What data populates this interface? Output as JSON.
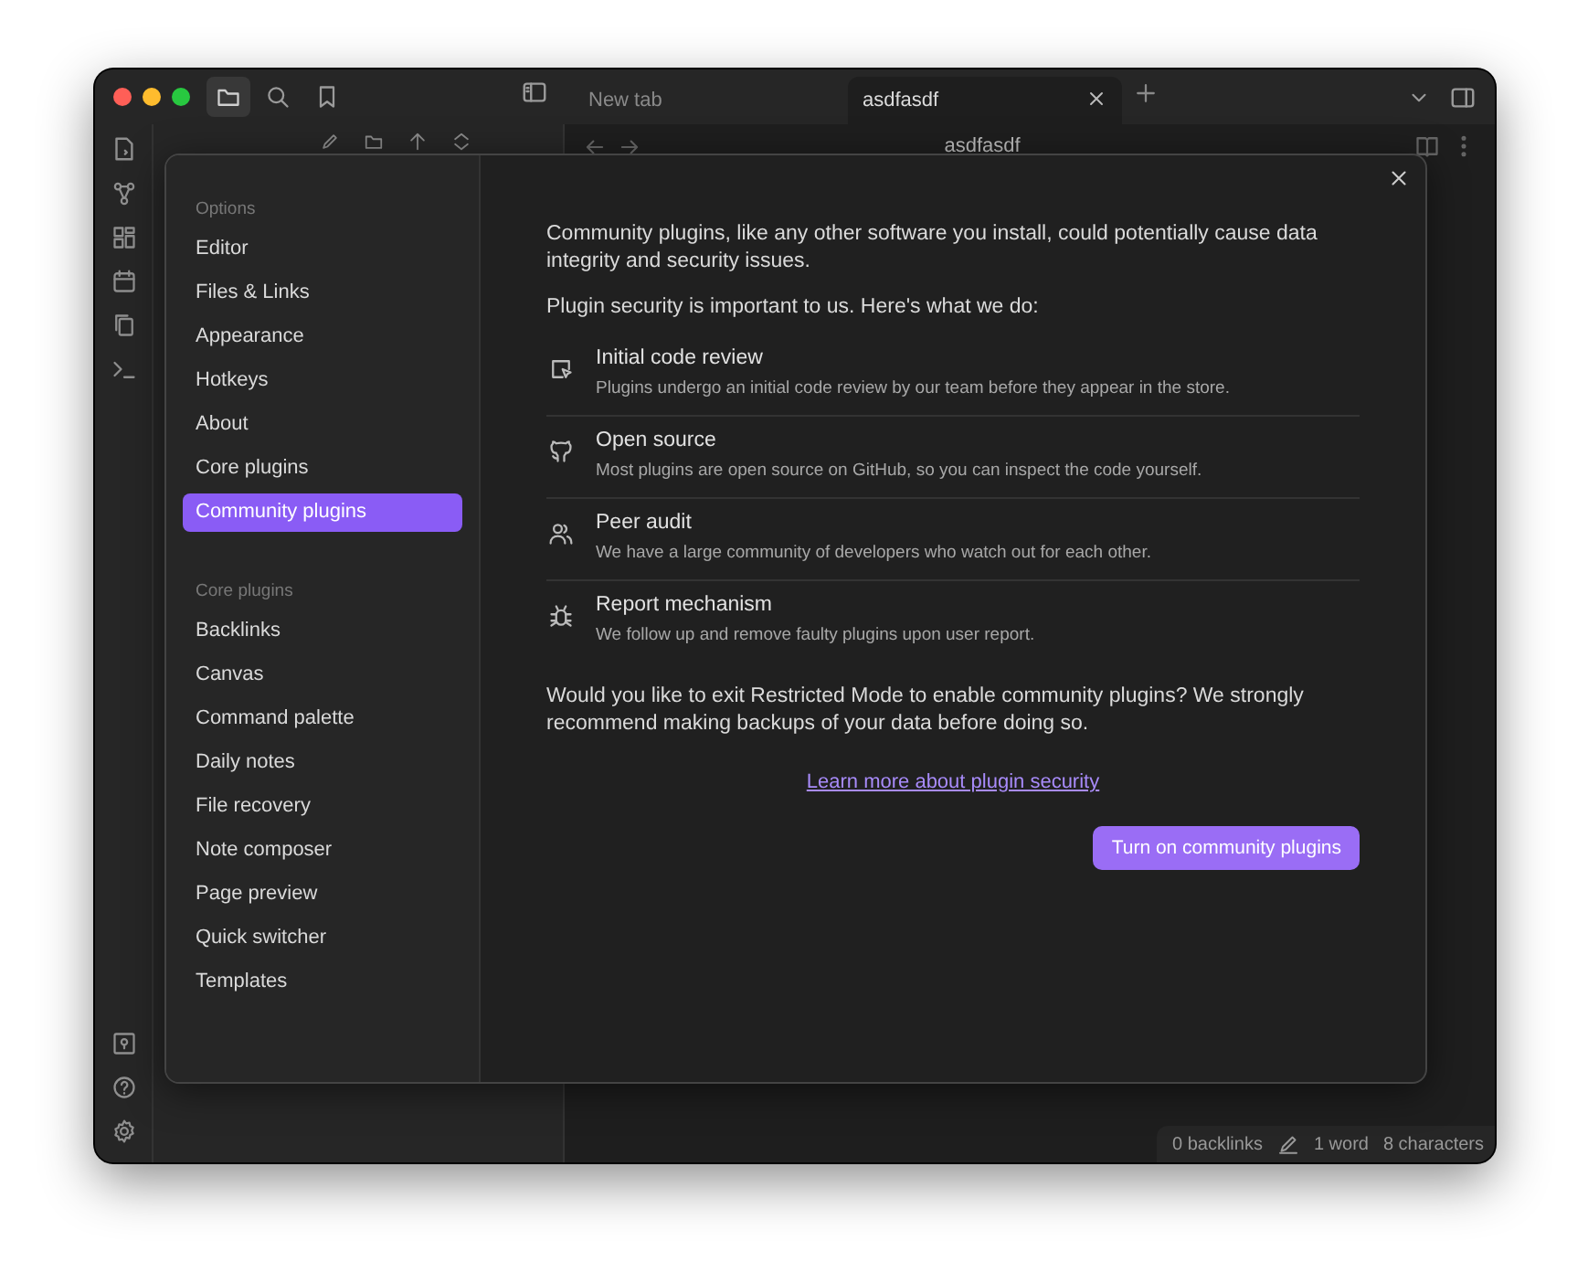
{
  "tab_bar": {
    "tools": [
      {
        "kind": "files",
        "selected": true
      },
      {
        "kind": "search",
        "selected": false
      },
      {
        "kind": "bookmarks",
        "selected": false
      }
    ],
    "tabs": [
      {
        "label": "New tab",
        "selected": false
      },
      {
        "label": "asdfasdf",
        "selected": true
      }
    ]
  },
  "view_header": {
    "title": "asdfasdf"
  },
  "settings": {
    "sections": [
      {
        "heading": "Options",
        "items": [
          {
            "label": "Editor",
            "selected": false
          },
          {
            "label": "Files & Links",
            "selected": false
          },
          {
            "label": "Appearance",
            "selected": false
          },
          {
            "label": "Hotkeys",
            "selected": false
          },
          {
            "label": "About",
            "selected": false
          },
          {
            "label": "Core plugins",
            "selected": false
          },
          {
            "label": "Community plugins",
            "selected": true
          }
        ]
      },
      {
        "heading": "Core plugins",
        "items": [
          {
            "label": "Backlinks",
            "selected": false
          },
          {
            "label": "Canvas",
            "selected": false
          },
          {
            "label": "Command palette",
            "selected": false
          },
          {
            "label": "Daily notes",
            "selected": false
          },
          {
            "label": "File recovery",
            "selected": false
          },
          {
            "label": "Note composer",
            "selected": false
          },
          {
            "label": "Page preview",
            "selected": false
          },
          {
            "label": "Quick switcher",
            "selected": false
          },
          {
            "label": "Templates",
            "selected": false
          }
        ]
      }
    ],
    "content": {
      "intro": "Community plugins, like any other software you install, could potentially cause data integrity and security issues.",
      "lead": "Plugin security is important to us. Here's what we do:",
      "features": [
        {
          "kind": "review",
          "title": "Initial code review",
          "description": "Plugins undergo an initial code review by our team before they appear in the store."
        },
        {
          "kind": "github",
          "title": "Open source",
          "description": "Most plugins are open source on GitHub, so you can inspect the code yourself."
        },
        {
          "kind": "users",
          "title": "Peer audit",
          "description": "We have a large community of developers who watch out for each other."
        },
        {
          "kind": "bug",
          "title": "Report mechanism",
          "description": "We follow up and remove faulty plugins upon user report."
        }
      ],
      "question": "Would you like to exit Restricted Mode to enable community plugins? We strongly recommend making backups of your data before doing so.",
      "link": "Learn more about plugin security",
      "button": "Turn on community plugins"
    }
  },
  "status_bar": {
    "backlinks": "0 backlinks",
    "words": "1 word",
    "characters": "8 characters"
  }
}
